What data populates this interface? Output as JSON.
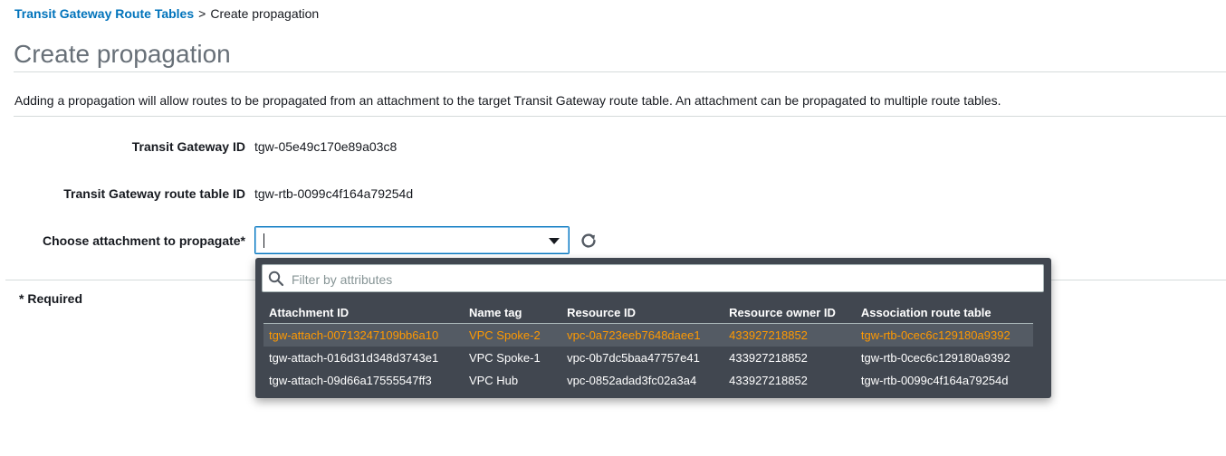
{
  "breadcrumb": {
    "link": "Transit Gateway Route Tables",
    "separator": ">",
    "current": "Create propagation"
  },
  "page_title": "Create propagation",
  "description": "Adding a propagation will allow routes to be propagated from an attachment to the target Transit Gateway route table. An attachment can be propagated to multiple route tables.",
  "fields": {
    "tgw_id_label": "Transit Gateway ID",
    "tgw_id_value": "tgw-05e49c170e89a03c8",
    "rtb_id_label": "Transit Gateway route table ID",
    "rtb_id_value": "tgw-rtb-0099c4f164a79254d",
    "attachment_label": "Choose attachment to propagate*",
    "attachment_value": ""
  },
  "required_note": "* Required",
  "dropdown": {
    "filter_placeholder": "Filter by attributes",
    "columns": [
      "Attachment ID",
      "Name tag",
      "Resource ID",
      "Resource owner ID",
      "Association route table"
    ],
    "rows": [
      [
        "tgw-attach-00713247109bb6a10",
        "VPC Spoke-2",
        "vpc-0a723eeb7648daee1",
        "433927218852",
        "tgw-rtb-0cec6c129180a9392"
      ],
      [
        "tgw-attach-016d31d348d3743e1",
        "VPC Spoke-1",
        "vpc-0b7dc5baa47757e41",
        "433927218852",
        "tgw-rtb-0cec6c129180a9392"
      ],
      [
        "tgw-attach-09d66a17555547ff3",
        "VPC Hub",
        "vpc-0852adad3fc02a3a4",
        "433927218852",
        "tgw-rtb-0099c4f164a79254d"
      ]
    ]
  },
  "icons": {
    "search": "search-icon",
    "refresh": "refresh-icon",
    "dropdown_arrow": "caret-down-icon"
  },
  "colors": {
    "link": "#0073bb",
    "highlight": "#ff9900",
    "dropdown_bg": "#414750"
  }
}
